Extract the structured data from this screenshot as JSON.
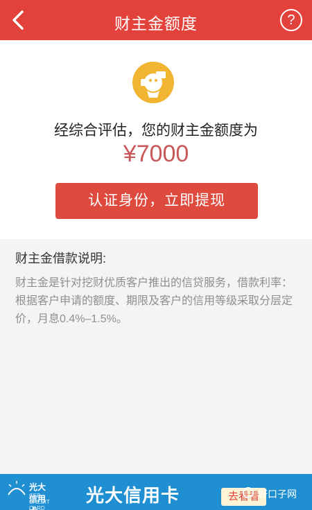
{
  "nav": {
    "title": "财主金额度",
    "help_label": "?"
  },
  "quota": {
    "evaluation_text": "经综合评估，您的财主金额度为",
    "amount": "¥7000",
    "action_label": "认证身份，立即提现"
  },
  "description": {
    "title": "财主金借款说明:",
    "body": "财主金是针对挖财优质客户推出的信贷服务，借款利率：根据客户申请的额度、期限及客户的信用等级采取分层定价，月息0.4%–1.5%。"
  },
  "ad": {
    "brand_small": "光大信用卡",
    "brand_small_sub": "CEB CREDIT CARD",
    "title": "光大信用卡",
    "cta_label": "去看看"
  },
  "watermark": {
    "text": "好口子网"
  },
  "colors": {
    "primary": "#e2423b",
    "amount": "#c9575a",
    "ad_bg": "#1f8fd1",
    "badge": "#f2b531"
  },
  "icons": {
    "back": "chevron-left-icon",
    "help": "question-circle-icon",
    "badge": "coins-badge-icon"
  }
}
